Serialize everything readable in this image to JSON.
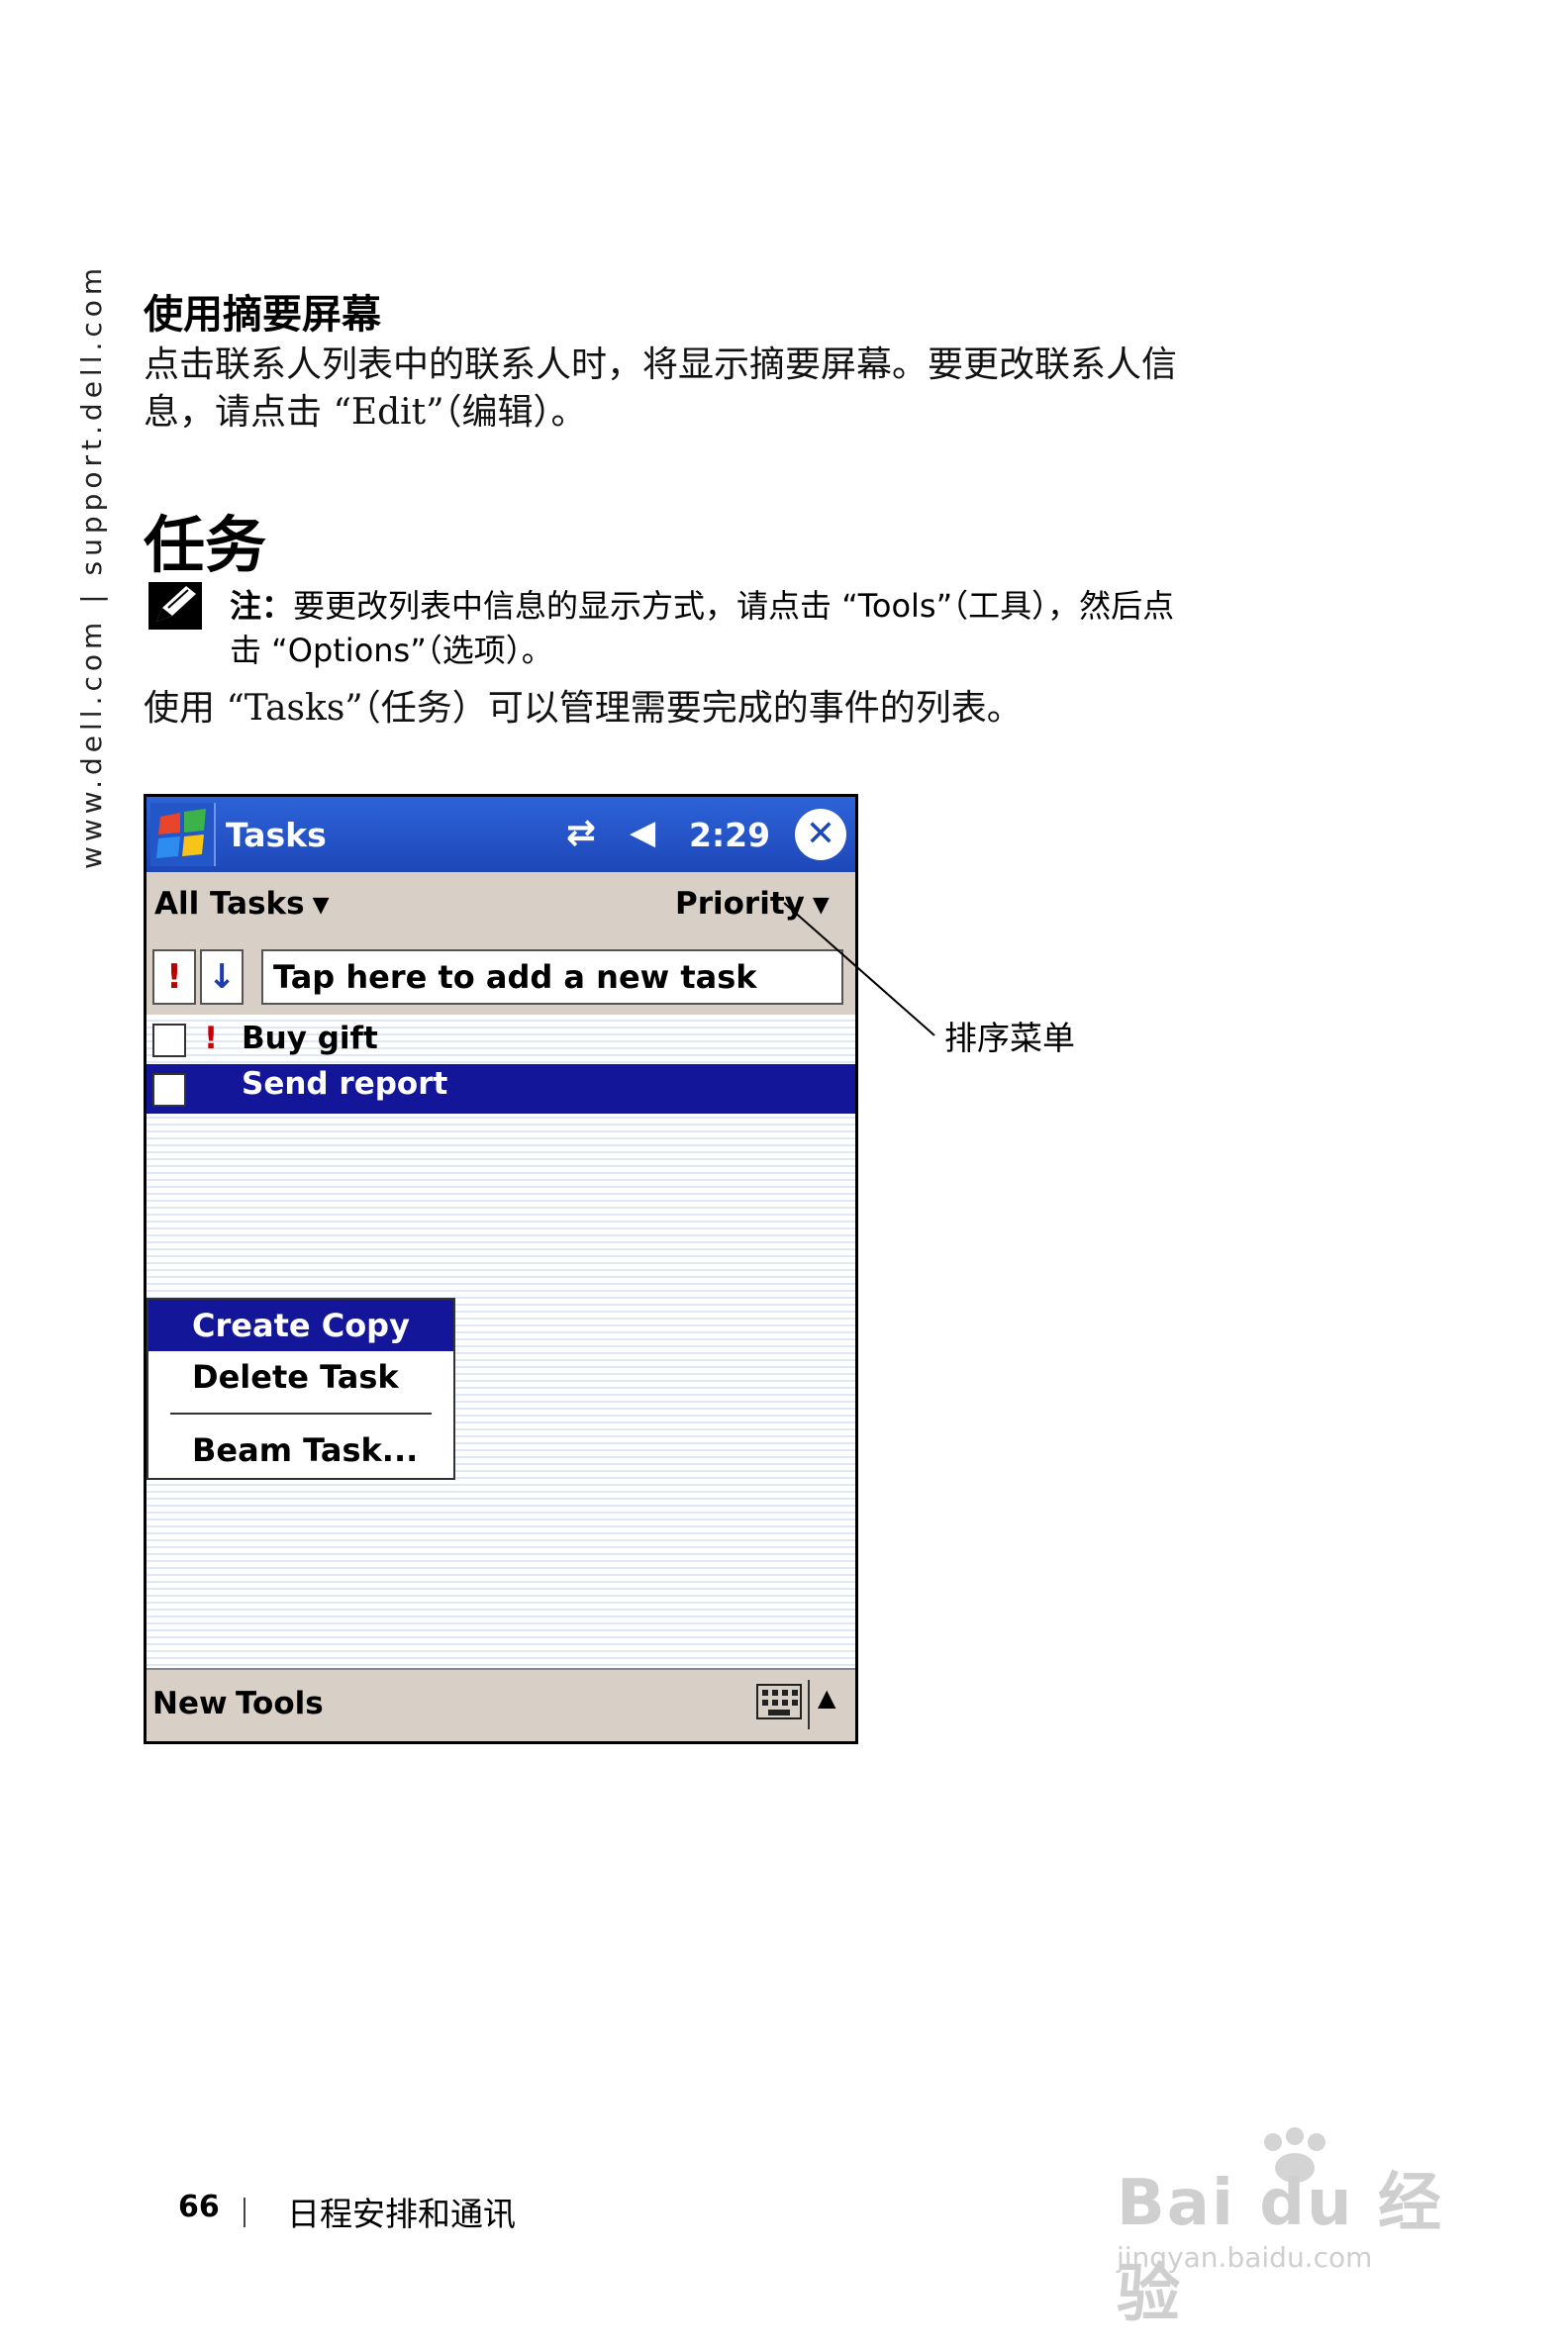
{
  "side_url": "www.dell.com | support.dell.com",
  "section": {
    "title": "使用摘要屏幕",
    "body_line1": "点击联系人列表中的联系人时，将显示摘要屏幕。要更改联系人信",
    "body_line2": "息，请点击 “Edit”（编辑）。"
  },
  "heading": "任务",
  "note": {
    "label": "注：",
    "line1": "要更改列表中信息的显示方式，请点击 “Tools”（工具），然后点",
    "line2": "击 “Options”（选项）。"
  },
  "intro": "使用 “Tasks”（任务）可以管理需要完成的事件的列表。",
  "pda": {
    "title": "Tasks",
    "time": "2:29",
    "filter": "All Tasks",
    "sort": "Priority",
    "entry_placeholder": "Tap here to add a new task",
    "priority_button": "!",
    "sort_button": "↓",
    "tasks": [
      {
        "label": "Buy gift",
        "priority": "!"
      },
      {
        "label": "Send report",
        "priority": ""
      }
    ],
    "context_menu": [
      "Create Copy",
      "Delete Task",
      "Beam Task..."
    ],
    "bottom_new": "New",
    "bottom_tools": "Tools"
  },
  "callout": "排序菜单",
  "footer": {
    "page_number": "66",
    "title": "日程安排和通讯"
  },
  "watermark": {
    "brand": "Bai du 经验",
    "url": "jingyan.baidu.com"
  },
  "colors": {
    "title_bar": "#1d47b8",
    "selection": "#14169a",
    "toolbar": "#d8d0c6",
    "priority_red": "#c00000"
  }
}
